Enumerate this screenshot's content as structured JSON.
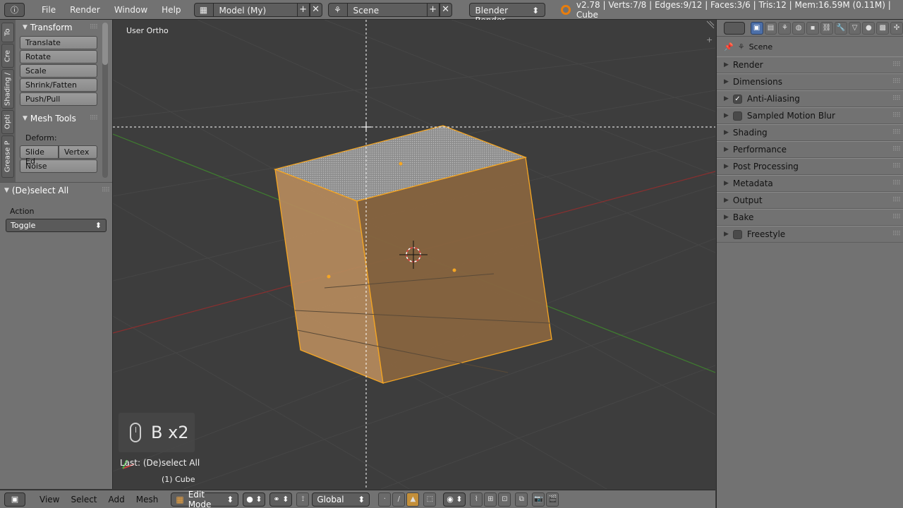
{
  "topbar": {
    "menus": [
      "File",
      "Render",
      "Window",
      "Help"
    ],
    "screen_layout": "Model (My)",
    "scene": "Scene",
    "render_engine": "Blender Render",
    "stats": "v2.78 | Verts:7/8 | Edges:9/12 | Faces:3/6 | Tris:12 | Mem:16.59M (0.11M) | Cube"
  },
  "toolshelf": {
    "tabs": [
      "To",
      "Cre",
      "Shading /",
      "Opti",
      "Grease P"
    ],
    "transform": {
      "title": "Transform",
      "buttons": [
        "Translate",
        "Rotate",
        "Scale",
        "Shrink/Fatten",
        "Push/Pull"
      ]
    },
    "mesh_tools": {
      "title": "Mesh Tools",
      "deform_label": "Deform:",
      "slide_edge": "Slide Ed",
      "vertex": "Vertex",
      "noise": "Noise"
    }
  },
  "redo_panel": {
    "title": "(De)select All",
    "action_label": "Action",
    "action_value": "Toggle"
  },
  "viewport": {
    "view_name": "User Ortho",
    "key": "B x2",
    "last_operator": "Last: (De)select All",
    "object": "(1) Cube"
  },
  "properties": {
    "context": "Scene",
    "panels": [
      {
        "label": "Render",
        "checkbox": null
      },
      {
        "label": "Dimensions",
        "checkbox": null
      },
      {
        "label": "Anti-Aliasing",
        "checkbox": true
      },
      {
        "label": "Sampled Motion Blur",
        "checkbox": false
      },
      {
        "label": "Shading",
        "checkbox": null
      },
      {
        "label": "Performance",
        "checkbox": null
      },
      {
        "label": "Post Processing",
        "checkbox": null
      },
      {
        "label": "Metadata",
        "checkbox": null
      },
      {
        "label": "Output",
        "checkbox": null
      },
      {
        "label": "Bake",
        "checkbox": null
      },
      {
        "label": "Freestyle",
        "checkbox": false
      }
    ]
  },
  "bottombar": {
    "menus": [
      "View",
      "Select",
      "Add",
      "Mesh"
    ],
    "mode": "Edit Mode",
    "orientation": "Global"
  },
  "colors": {
    "selection": "#f5a623",
    "face_fill": "#b58a5c",
    "x_axis": "#8a2f2f",
    "y_axis": "#3f7f2f",
    "grid": "#474747"
  }
}
